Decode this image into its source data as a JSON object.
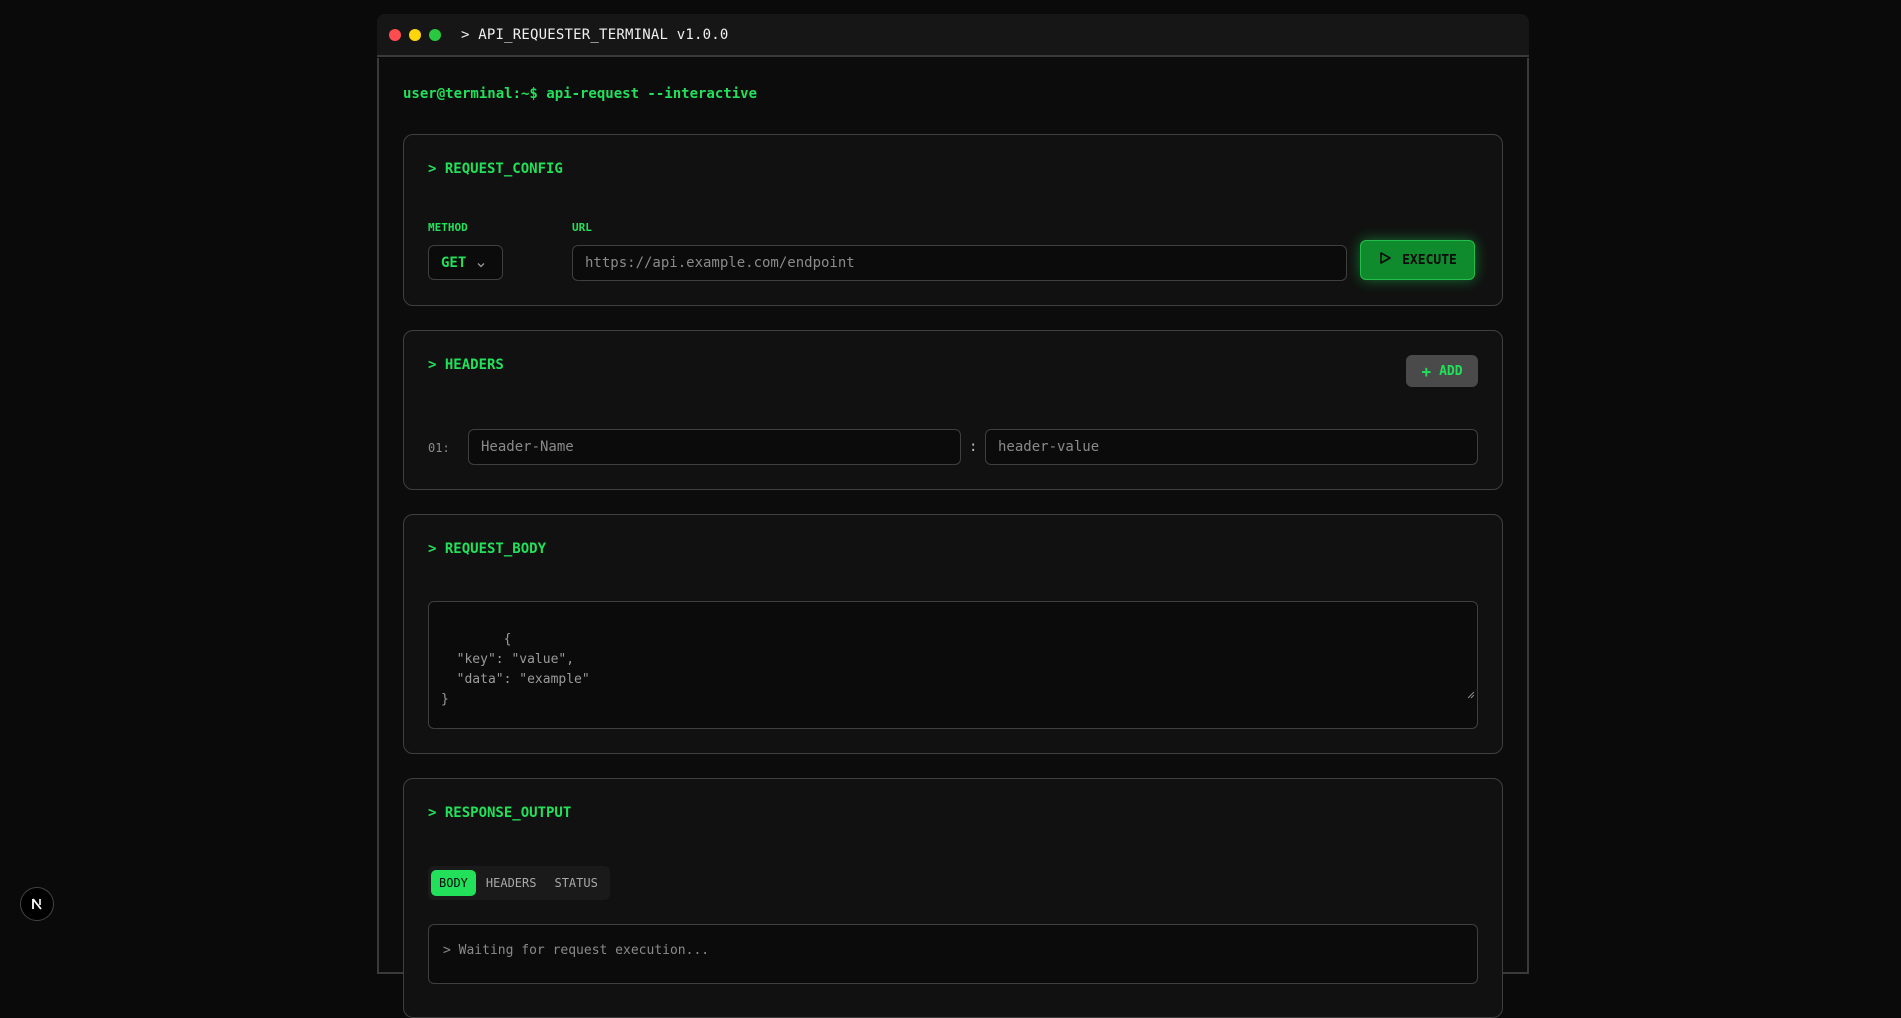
{
  "window": {
    "title": "> API_REQUESTER_TERMINAL v1.0.0"
  },
  "prompt": "user@terminal:~$ api-request --interactive",
  "request_config": {
    "title": "> REQUEST_CONFIG",
    "method_label": "METHOD",
    "method_value": "GET",
    "url_label": "URL",
    "url_placeholder": "https://api.example.com/endpoint",
    "execute_label": "EXECUTE"
  },
  "headers": {
    "title": "> HEADERS",
    "add_label": "ADD",
    "rows": [
      {
        "index": "01:",
        "name_placeholder": "Header-Name",
        "value_placeholder": "header-value"
      }
    ],
    "separator": ":"
  },
  "request_body": {
    "title": "> REQUEST_BODY",
    "placeholder": "{\n  \"key\": \"value\",\n  \"data\": \"example\"\n}"
  },
  "response_output": {
    "title": "> RESPONSE_OUTPUT",
    "tabs": [
      "BODY",
      "HEADERS",
      "STATUS"
    ],
    "active_tab": "BODY",
    "output_text": "> Waiting for request execution..."
  },
  "colors": {
    "accent": "#22e05a",
    "background": "#0a0a0a",
    "panel": "#111111",
    "border": "#3f3f3f"
  },
  "icons": {
    "window_controls": [
      "close-dot",
      "minimize-dot",
      "maximize-dot"
    ],
    "method_select": "chevron-down-icon",
    "execute": "play-icon",
    "add": "plus-icon",
    "bottom_left": "nextjs-logo"
  }
}
